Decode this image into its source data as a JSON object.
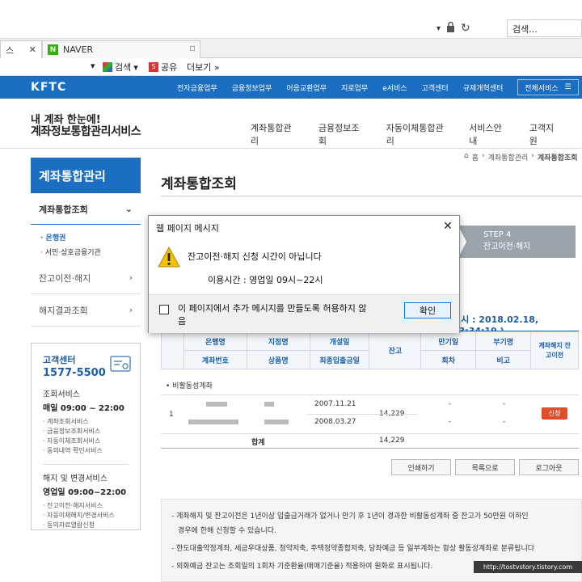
{
  "browser": {
    "search_placeholder": "검색...",
    "tabs": [
      {
        "label": "스"
      },
      {
        "label": "NAVER"
      }
    ],
    "toolbar": {
      "search_label": "검색",
      "share_label": "공유",
      "more_label": "더보기 »"
    }
  },
  "site": {
    "logo": "KFTC",
    "gnav": [
      "전자금융업무",
      "금융정보업무",
      "어음교환업무",
      "지로업무",
      "e서비스",
      "고객센터",
      "규제개혁센터"
    ],
    "all_services": "전체서비스",
    "brand_line1": "내 계좌 한눈에!",
    "brand_line2": "계좌정보통합관리서비스",
    "main_nav": [
      "계좌통합관리",
      "금융정보조회",
      "자동이체통합관리",
      "서비스안내",
      "고객지원"
    ],
    "breadcrumb": [
      "홈",
      "계좌통합관리",
      "계좌통합조회"
    ]
  },
  "sidebar": {
    "title": "계좌통합관리",
    "section1": "계좌통합조회",
    "sub_items": [
      "· 은행권",
      "· 서민·상호금융기관"
    ],
    "section2": "잔고이전·해지",
    "section3": "해지결과조회",
    "help": {
      "label": "고객센터",
      "phone": "1577-5500",
      "lookup_title": "조회서비스",
      "lookup_hours": "매일 09:00 ~ 22:00",
      "lookup_items": [
        "· 계좌조회서비스",
        "· 금융정보조회서비스",
        "· 자동이체조회서비스",
        "· 동의내역 확인서비스"
      ],
      "change_title": "해지 및 변경서비스",
      "change_hours": "영업일 09:00~22:00",
      "change_items": [
        "· 잔고이전·해지서비스",
        "· 자동이체해지/변경서비스",
        "· 동의자료열람신청"
      ]
    }
  },
  "main": {
    "title": "계좌통합조회",
    "step4_line1": "STEP 4",
    "step4_line2": "잔고이전·해지",
    "datetime": "일시 : 2018.02.18, 13:34:19 )",
    "table": {
      "headers_top": [
        "은행명",
        "지점명",
        "개설일",
        "잔고",
        "만기일",
        "부기명",
        "계좌해지 잔고이전"
      ],
      "headers_bottom": [
        "계좌번호",
        "상품명",
        "최종입출금일",
        "회차",
        "비고"
      ],
      "group_label": "• 비활동성계좌",
      "row_index": "1",
      "open_date": "2007.11.21",
      "last_date": "2008.03.27",
      "balance": "14,229",
      "maturity_dash": "-",
      "maturity_dash2": "-",
      "memo_dash": "-",
      "memo_dash2": "-",
      "apply_label": "신청",
      "total_label": "합계",
      "total_balance": "14,229"
    },
    "buttons": {
      "print": "인쇄하기",
      "list": "목록으로",
      "logout": "로그아웃"
    },
    "notices": [
      "- 계좌해지 및 잔고이전은 1년이상 입출금거래가 없거나 만기 후 1년이 경과한 비활동성계좌 중 잔고가 50만원 이하인",
      "경우에 한해 신청할 수 있습니다.",
      "- 한도대출약정계좌, 세금우대상품, 청약저축, 주택청약종합저축, 당좌예금 등 일부계좌는 항상 활동성계좌로 분류됩니다",
      "- 외화예금 잔고는 조회일의 1회차 기준환율(매매기준율) 적용하여 원화로 표시됩니다."
    ],
    "watermark": "http://tostvstory.tistory.com"
  },
  "dialog": {
    "title": "웹 페이지 메시지",
    "message": "잔고이전·해지 신청 시간이 아닙니다",
    "hours": "이용시간 : 영업일 09시~22시",
    "checkbox_label": "이 페이지에서 추가 메시지를 만들도록 허용하지 않음",
    "ok": "확인"
  },
  "colors": {
    "brand_blue": "#1b6ec2",
    "apply_red": "#e04f2c",
    "warning_yellow": "#f2c200"
  }
}
